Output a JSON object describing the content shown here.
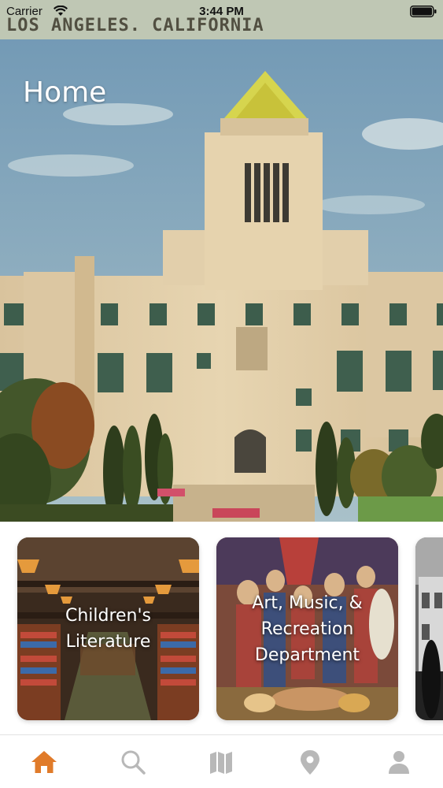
{
  "status_bar": {
    "carrier": "Carrier",
    "time": "3:44 PM"
  },
  "hero": {
    "title": "Home",
    "postcard_caption": "LOS ANGELES. CALIFORNIA"
  },
  "cards": [
    {
      "label": "Children's\nLiterature"
    },
    {
      "label": "Art, Music, &\nRecreation\nDepartment"
    },
    {
      "label": ""
    }
  ],
  "tab_bar": {
    "active_color": "#e07b2a",
    "inactive_color": "#b8b8b8",
    "items": [
      {
        "icon": "home-icon",
        "active": true
      },
      {
        "icon": "search-icon",
        "active": false
      },
      {
        "icon": "map-icon",
        "active": false
      },
      {
        "icon": "location-pin-icon",
        "active": false
      },
      {
        "icon": "profile-icon",
        "active": false
      }
    ]
  }
}
